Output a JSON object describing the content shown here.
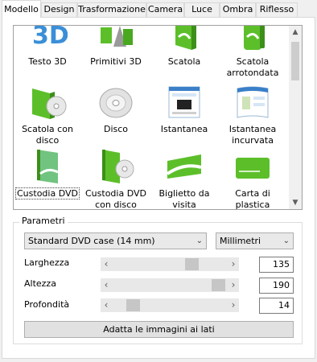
{
  "tabs": [
    {
      "label": "Modello",
      "active": true
    },
    {
      "label": "Design"
    },
    {
      "label": "Trasformazione"
    },
    {
      "label": "Camera"
    },
    {
      "label": "Luce"
    },
    {
      "label": "Ombra"
    },
    {
      "label": "Riflesso"
    }
  ],
  "gallery": {
    "items": [
      {
        "label": "Testo 3D",
        "icon": "text-3d-icon"
      },
      {
        "label": "Primitivi 3D",
        "icon": "primitives-3d-icon"
      },
      {
        "label": "Scatola",
        "icon": "box-icon"
      },
      {
        "label": "Scatola arrotondata",
        "icon": "rounded-box-icon"
      },
      {
        "label": "Scatola con disco",
        "icon": "box-with-disc-icon"
      },
      {
        "label": "Disco",
        "icon": "disc-icon"
      },
      {
        "label": "Istantanea",
        "icon": "screenshot-icon"
      },
      {
        "label": "Istantanea incurvata",
        "icon": "curved-screenshot-icon"
      },
      {
        "label": "Custodia DVD",
        "icon": "dvd-case-icon",
        "selected": true
      },
      {
        "label": "Custodia DVD con disco",
        "icon": "dvd-case-with-disc-icon"
      },
      {
        "label": "Biglietto da visita",
        "icon": "business-card-icon"
      },
      {
        "label": "Carta di plastica",
        "icon": "plastic-card-icon"
      }
    ]
  },
  "params": {
    "title": "Parametri",
    "preset": "Standard DVD case (14 mm)",
    "unit": "Millimetri",
    "rows": [
      {
        "label": "Larghezza",
        "value": "135",
        "level": 0.72
      },
      {
        "label": "Altezza",
        "value": "190",
        "level": 0.98
      },
      {
        "label": "Profondità",
        "value": "14",
        "level": 0.14
      }
    ],
    "fit_button": "Adatta le immagini ai lati"
  },
  "colors": {
    "accent_green": "#5cbf2a",
    "white": "#ffffff"
  }
}
